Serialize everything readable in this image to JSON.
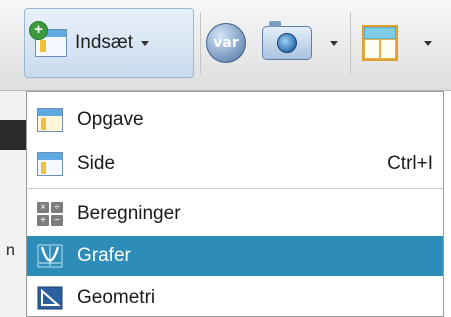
{
  "toolbar": {
    "insert_label": "Indsæt",
    "var_label": "var"
  },
  "background": {
    "partial_letter": "n"
  },
  "menu": {
    "items": [
      {
        "label": "Opgave",
        "shortcut": "",
        "icon": "problem-icon"
      },
      {
        "label": "Side",
        "shortcut": "Ctrl+I",
        "icon": "page-icon"
      },
      {
        "label": "Beregninger",
        "shortcut": "",
        "icon": "calculator-icon"
      },
      {
        "label": "Grafer",
        "shortcut": "",
        "icon": "graphs-icon",
        "selected": true
      },
      {
        "label": "Geometri",
        "shortcut": "",
        "icon": "geometry-icon"
      }
    ]
  },
  "colors": {
    "selection": "#2e8cb8",
    "toolbar": "#e6e6e6"
  }
}
